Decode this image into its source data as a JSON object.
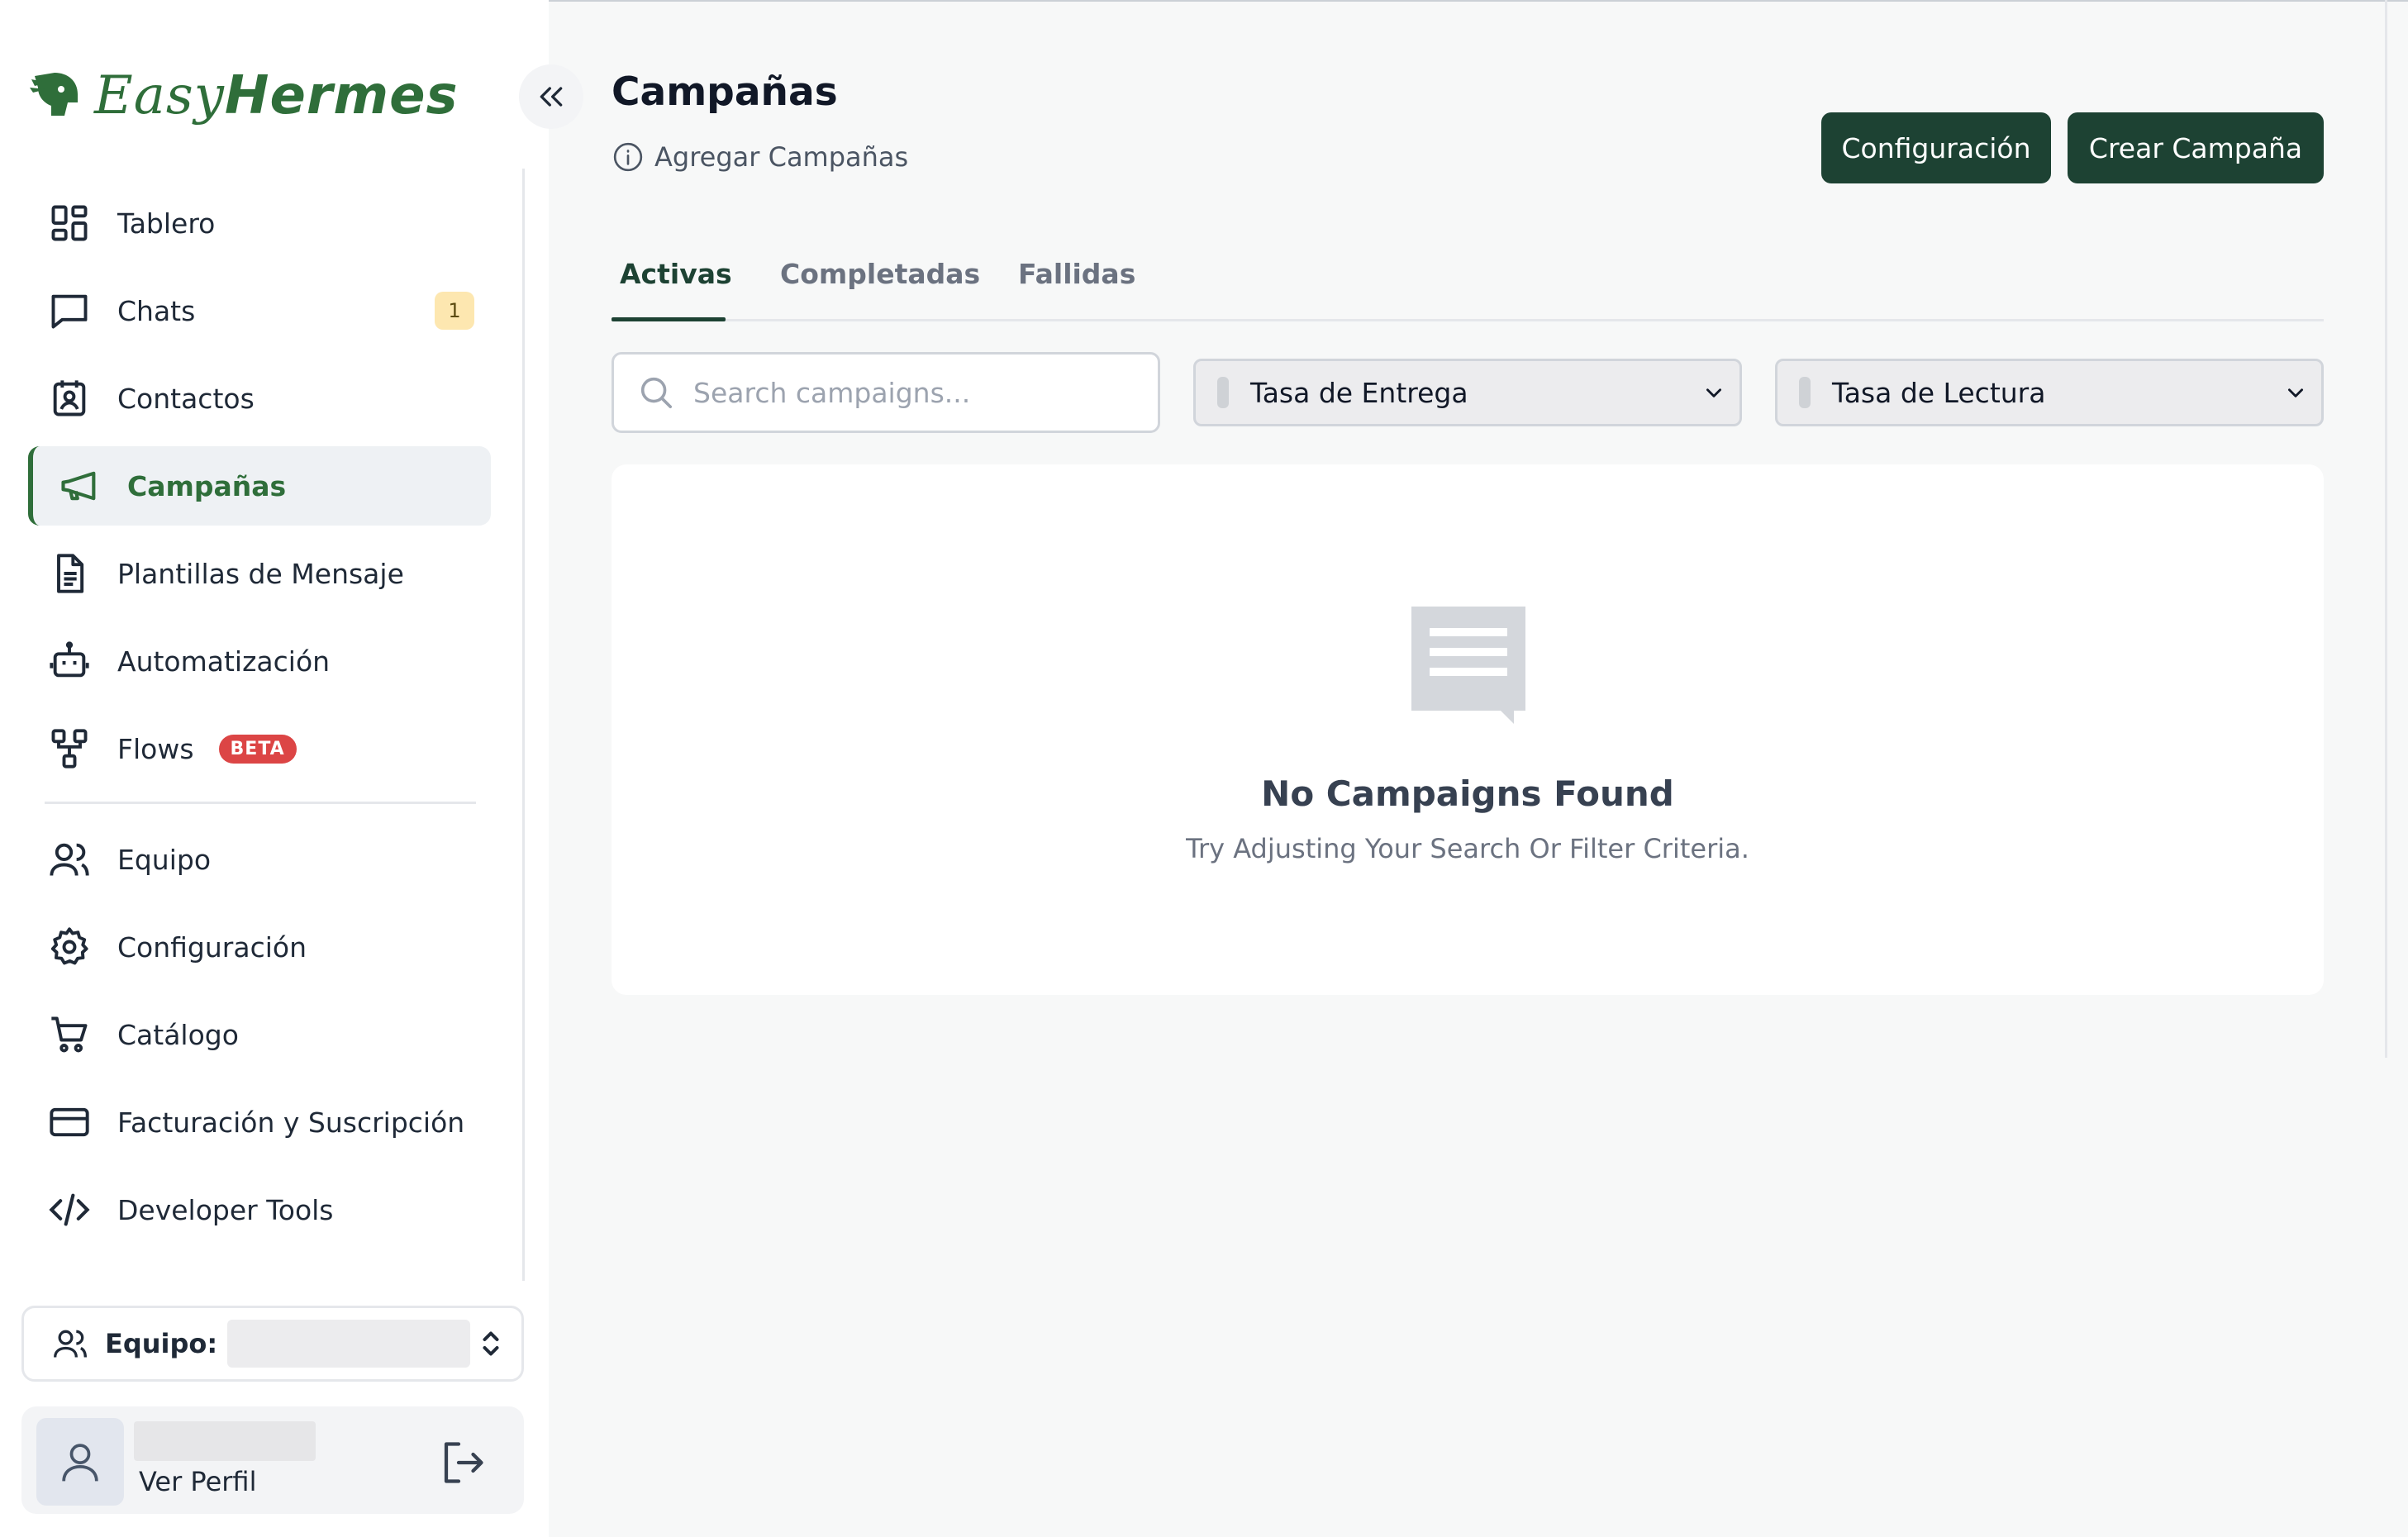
{
  "brand": {
    "name_light": "Easy",
    "name_bold": "Hermes",
    "color": "#2f6e3a"
  },
  "sidebar": {
    "items": [
      {
        "label": "Tablero",
        "icon": "dashboard-icon"
      },
      {
        "label": "Chats",
        "icon": "chat-icon",
        "badge": "1"
      },
      {
        "label": "Contactos",
        "icon": "contact-card-icon"
      },
      {
        "label": "Campañas",
        "icon": "megaphone-icon",
        "active": true
      },
      {
        "label": "Plantillas de Mensaje",
        "icon": "document-icon"
      },
      {
        "label": "Automatización",
        "icon": "robot-icon"
      },
      {
        "label": "Flows",
        "icon": "flow-icon",
        "tag": "BETA"
      },
      {
        "label": "Equipo",
        "icon": "team-icon"
      },
      {
        "label": "Configuración",
        "icon": "gear-icon"
      },
      {
        "label": "Catálogo",
        "icon": "cart-icon"
      },
      {
        "label": "Facturación y Suscripción",
        "icon": "credit-card-icon"
      },
      {
        "label": "Developer Tools",
        "icon": "code-icon"
      }
    ],
    "team_label": "Equipo:",
    "profile_link": "Ver Perfil"
  },
  "header": {
    "title": "Campañas",
    "subtitle": "Agregar Campañas",
    "config_button": "Configuración",
    "create_button": "Crear Campaña"
  },
  "tabs": [
    {
      "label": "Activas",
      "active": true
    },
    {
      "label": "Completadas"
    },
    {
      "label": "Fallidas"
    }
  ],
  "filters": {
    "search_placeholder": "Search campaigns...",
    "delivery_rate": "Tasa de Entrega",
    "read_rate": "Tasa de Lectura"
  },
  "empty_state": {
    "title": "No Campaigns Found",
    "subtitle": "Try Adjusting Your Search Or Filter Criteria."
  },
  "colors": {
    "primary_dark": "#1d4233",
    "accent_green": "#2f6e3a",
    "badge_yellow": "#fde7b0",
    "beta_red": "#dc4545"
  }
}
